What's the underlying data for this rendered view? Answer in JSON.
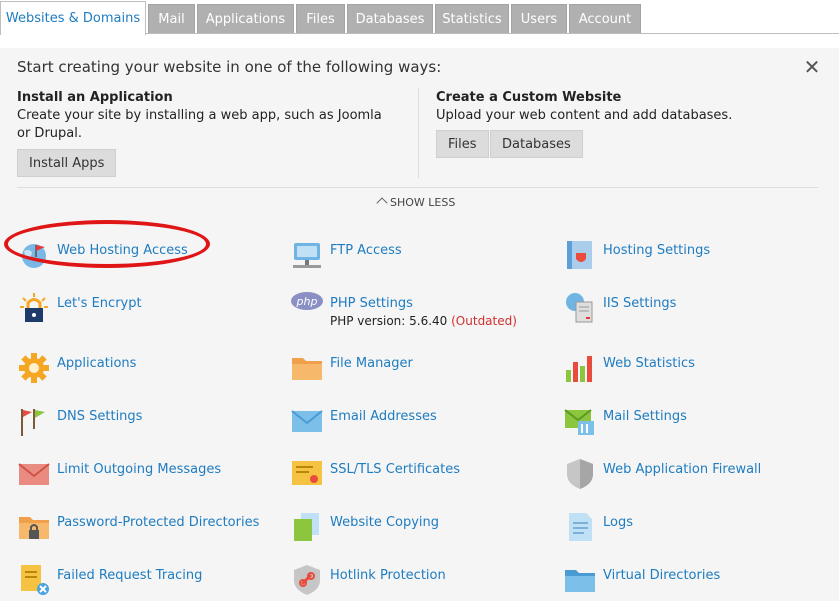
{
  "tabs": [
    {
      "label": "Websites & Domains",
      "active": true
    },
    {
      "label": "Mail"
    },
    {
      "label": "Applications"
    },
    {
      "label": "Files"
    },
    {
      "label": "Databases"
    },
    {
      "label": "Statistics"
    },
    {
      "label": "Users"
    },
    {
      "label": "Account"
    }
  ],
  "panel": {
    "title": "Start creating your website in one of the following ways:",
    "install": {
      "title": "Install an Application",
      "desc": "Create your site by installing a web app, such as Joomla or Drupal.",
      "button": "Install Apps"
    },
    "custom": {
      "title": "Create a Custom Website",
      "desc": "Upload your web content and add databases.",
      "files_button": "Files",
      "databases_button": "Databases"
    },
    "show_less": "SHOW LESS"
  },
  "tools": [
    {
      "label": "Web Hosting Access",
      "icon": "web-hosting-icon"
    },
    {
      "label": "FTP Access",
      "icon": "ftp-icon"
    },
    {
      "label": "Hosting Settings",
      "icon": "hosting-settings-icon"
    },
    {
      "label": "Let's Encrypt",
      "icon": "lock-icon"
    },
    {
      "label": "PHP Settings",
      "icon": "php-icon"
    },
    {
      "label": "IIS Settings",
      "icon": "iis-icon"
    },
    {
      "label": "Applications",
      "icon": "gear-icon"
    },
    {
      "label": "File Manager",
      "icon": "folder-icon"
    },
    {
      "label": "Web Statistics",
      "icon": "bar-chart-icon"
    },
    {
      "label": "DNS Settings",
      "icon": "dns-flags-icon"
    },
    {
      "label": "Email Addresses",
      "icon": "envelope-icon"
    },
    {
      "label": "Mail Settings",
      "icon": "mail-settings-icon"
    },
    {
      "label": "Limit Outgoing Messages",
      "icon": "envelope-red-icon"
    },
    {
      "label": "SSL/TLS Certificates",
      "icon": "certificate-icon"
    },
    {
      "label": "Web Application Firewall",
      "icon": "shield-icon"
    },
    {
      "label": "Password-Protected Directories",
      "icon": "locked-folder-icon"
    },
    {
      "label": "Website Copying",
      "icon": "copy-icon"
    },
    {
      "label": "Logs",
      "icon": "log-icon"
    },
    {
      "label": "Failed Request Tracing",
      "icon": "failed-request-icon"
    },
    {
      "label": "Hotlink Protection",
      "icon": "hotlink-icon"
    },
    {
      "label": "Virtual Directories",
      "icon": "virtual-folder-icon"
    }
  ],
  "php_version": {
    "label": "PHP version: 5.6.40",
    "status": "(Outdated)"
  },
  "colors": {
    "link": "#1e7cc1",
    "tab_inactive": "#b0b0b0",
    "highlight": "#e01515",
    "warning": "#d0302f"
  }
}
